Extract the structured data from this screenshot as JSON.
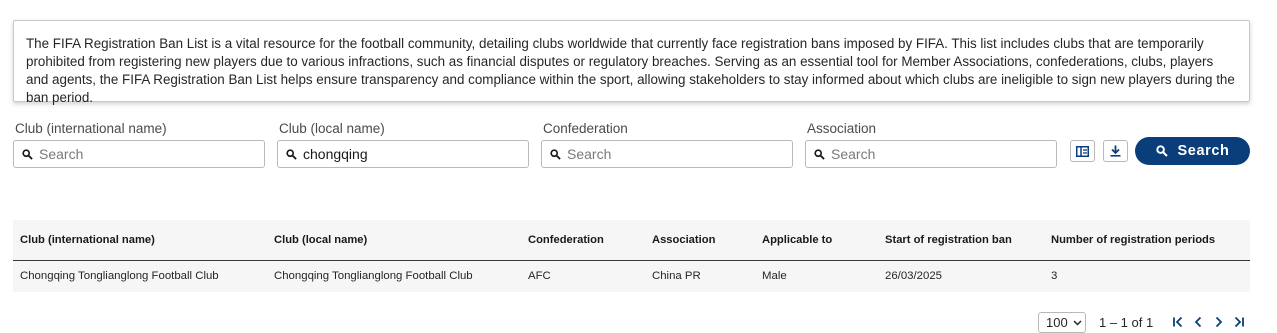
{
  "info": {
    "text": "The FIFA Registration Ban List is a vital resource for the football community, detailing clubs worldwide that currently face registration bans imposed by FIFA. This list includes clubs that are temporarily prohibited from registering new players due to various infractions, such as financial disputes or regulatory breaches. Serving as an essential tool for Member Associations, confederations, clubs, players and agents, the FIFA Registration Ban List helps ensure transparency and compliance within the sport, allowing stakeholders to stay informed about which clubs are ineligible to sign new players during the ban period."
  },
  "filters": {
    "club_international": {
      "label": "Club (international name)",
      "placeholder": "Search",
      "value": ""
    },
    "club_local": {
      "label": "Club (local name)",
      "placeholder": "Search",
      "value": "chongqing"
    },
    "confederation": {
      "label": "Confederation",
      "placeholder": "Search",
      "value": ""
    },
    "association": {
      "label": "Association",
      "placeholder": "Search",
      "value": ""
    }
  },
  "toolbar": {
    "columns_icon": "columns-icon",
    "download_icon": "download-icon",
    "search_label": "Search"
  },
  "table": {
    "headers": [
      "Club (international name)",
      "Club (local name)",
      "Confederation",
      "Association",
      "Applicable to",
      "Start of registration ban",
      "Number of registration periods"
    ],
    "rows": [
      [
        "Chongqing Tongliang­long Football Club",
        "Chongqing Tongliang­long Football Club",
        "AFC",
        "China PR",
        "Male",
        "26/03/2025",
        "3"
      ]
    ]
  },
  "pagination": {
    "page_size": "100",
    "range": "1 – 1 of 1"
  },
  "colors": {
    "primary": "#0a3e7a",
    "border": "#b9b9b9",
    "row_bg": "#f6f6f6"
  }
}
